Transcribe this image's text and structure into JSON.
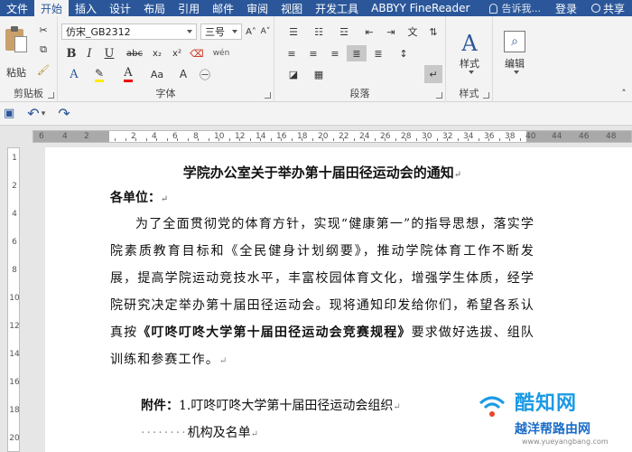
{
  "tabs": [
    "文件",
    "开始",
    "插入",
    "设计",
    "布局",
    "引用",
    "邮件",
    "审阅",
    "视图",
    "开发工具",
    "ABBYY FineReader"
  ],
  "active_tab": "开始",
  "tell_me": "告诉我...",
  "login": "登录",
  "share": "共享",
  "ribbon": {
    "clipboard": {
      "paste": "粘贴",
      "label": "剪贴板"
    },
    "font": {
      "name": "仿宋_GB2312",
      "size": "三号",
      "label": "字体",
      "bold": "B",
      "italic": "I",
      "underline": "U",
      "strike": "abc",
      "sub": "x₂",
      "sup": "x²",
      "aa": "Aa",
      "grow": "A",
      "shrink": "A",
      "wen": "wén",
      "a_letter": "A"
    },
    "paragraph": {
      "label": "段落"
    },
    "styles": {
      "label": "样式",
      "btn": "样式"
    },
    "editing": {
      "btn": "编辑"
    }
  },
  "ruler": {
    "left_numbers": [
      "6",
      "4",
      "2"
    ],
    "right_numbers": [
      "2",
      "4",
      "6",
      "8",
      "10",
      "12",
      "14",
      "16",
      "18",
      "20",
      "22",
      "24",
      "26",
      "28",
      "30",
      "32",
      "34",
      "36",
      "38",
      "40"
    ],
    "far_numbers": [
      "44",
      "46",
      "48"
    ]
  },
  "vruler": [
    "1",
    "2",
    "4",
    "6",
    "8",
    "10",
    "12",
    "14",
    "16",
    "18",
    "20"
  ],
  "doc": {
    "title": "学院办公室关于举办第十届田径运动会的通知",
    "salute": "各单位：",
    "para1a": "为了全面贯彻党的体育方针，实现“健康第一”的指导思想，落实学院素质教育目标和《全民健身计划纲要》，推动学院体育工作不断发展，提高学院运动竞技水平，丰富校园体育文化，增强学生体质，经学院研究决定举办第十届田径运动会。现将通知印发给你们，希望各系认真按",
    "para1b": "《叮咚叮咚大学第十届田径运动会竞赛规程》",
    "para1c": "要求做好选拔、组队训练和参赛工作。",
    "attach_label": "附件：",
    "attach_1": "1.叮咚叮咚大学第十届田径运动会组织",
    "attach_2": "机构及名单",
    "para_mark": "↵"
  },
  "watermark": {
    "title": "酷知网",
    "subtitle": "越洋帮路由网",
    "url": "www.yueyangbang.com"
  }
}
